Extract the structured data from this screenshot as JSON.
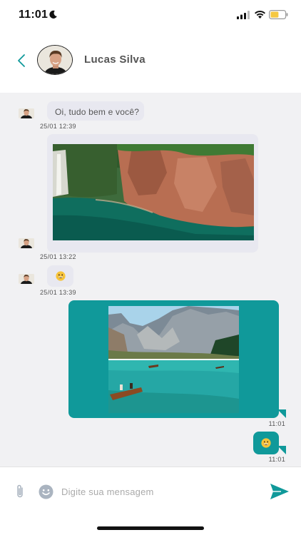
{
  "status_bar": {
    "time": "11:01",
    "icons": [
      "moon-icon",
      "signal-icon",
      "wifi-icon",
      "battery-icon"
    ],
    "battery_color": "#f5c842"
  },
  "header": {
    "contact_name": "Lucas Silva",
    "back_icon": "chevron-left-icon"
  },
  "messages": [
    {
      "direction": "incoming",
      "type": "text",
      "text": "Oi, tudo bem e você?",
      "timestamp": "25/01 12:39"
    },
    {
      "direction": "incoming",
      "type": "image",
      "image": "canyon lake with cliffs and waterfall",
      "timestamp": "25/01 13:22"
    },
    {
      "direction": "incoming",
      "type": "emoji",
      "emoji": "grinning-face",
      "timestamp": "25/01 13:39"
    },
    {
      "direction": "outgoing",
      "type": "image",
      "image": "mountain lake with rowing boats",
      "timestamp": "11:01"
    },
    {
      "direction": "outgoing",
      "type": "emoji",
      "emoji": "grinning-face",
      "timestamp": "11:01"
    }
  ],
  "composer": {
    "placeholder": "Digite sua mensagem",
    "attach_icon": "paperclip-icon",
    "emoji_icon": "smiley-icon",
    "send_icon": "send-icon"
  },
  "colors": {
    "accent": "#10999a",
    "incoming_bubble": "#e8e8f0",
    "chat_background": "#f1f1f3"
  }
}
